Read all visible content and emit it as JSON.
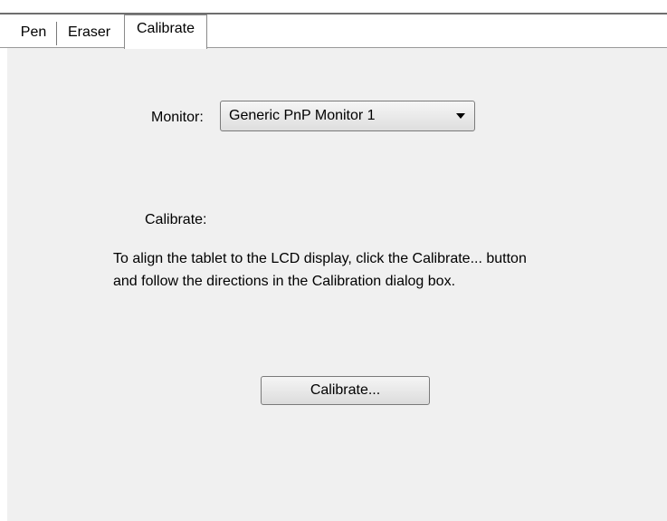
{
  "tabs": {
    "pen": "Pen",
    "eraser": "Eraser",
    "calibrate": "Calibrate"
  },
  "monitor": {
    "label": "Monitor:",
    "selected": "Generic PnP Monitor 1"
  },
  "calibrate_section": {
    "label": "Calibrate:",
    "instructions_line1": "To align the tablet to the LCD display, click the Calibrate... button",
    "instructions_line2": "and follow the directions in the Calibration dialog box.",
    "button_label": "Calibrate..."
  },
  "colors": {
    "panel_background": "#f0f0f0",
    "page_background": "#ffffff",
    "border": "#7a7a7a"
  }
}
